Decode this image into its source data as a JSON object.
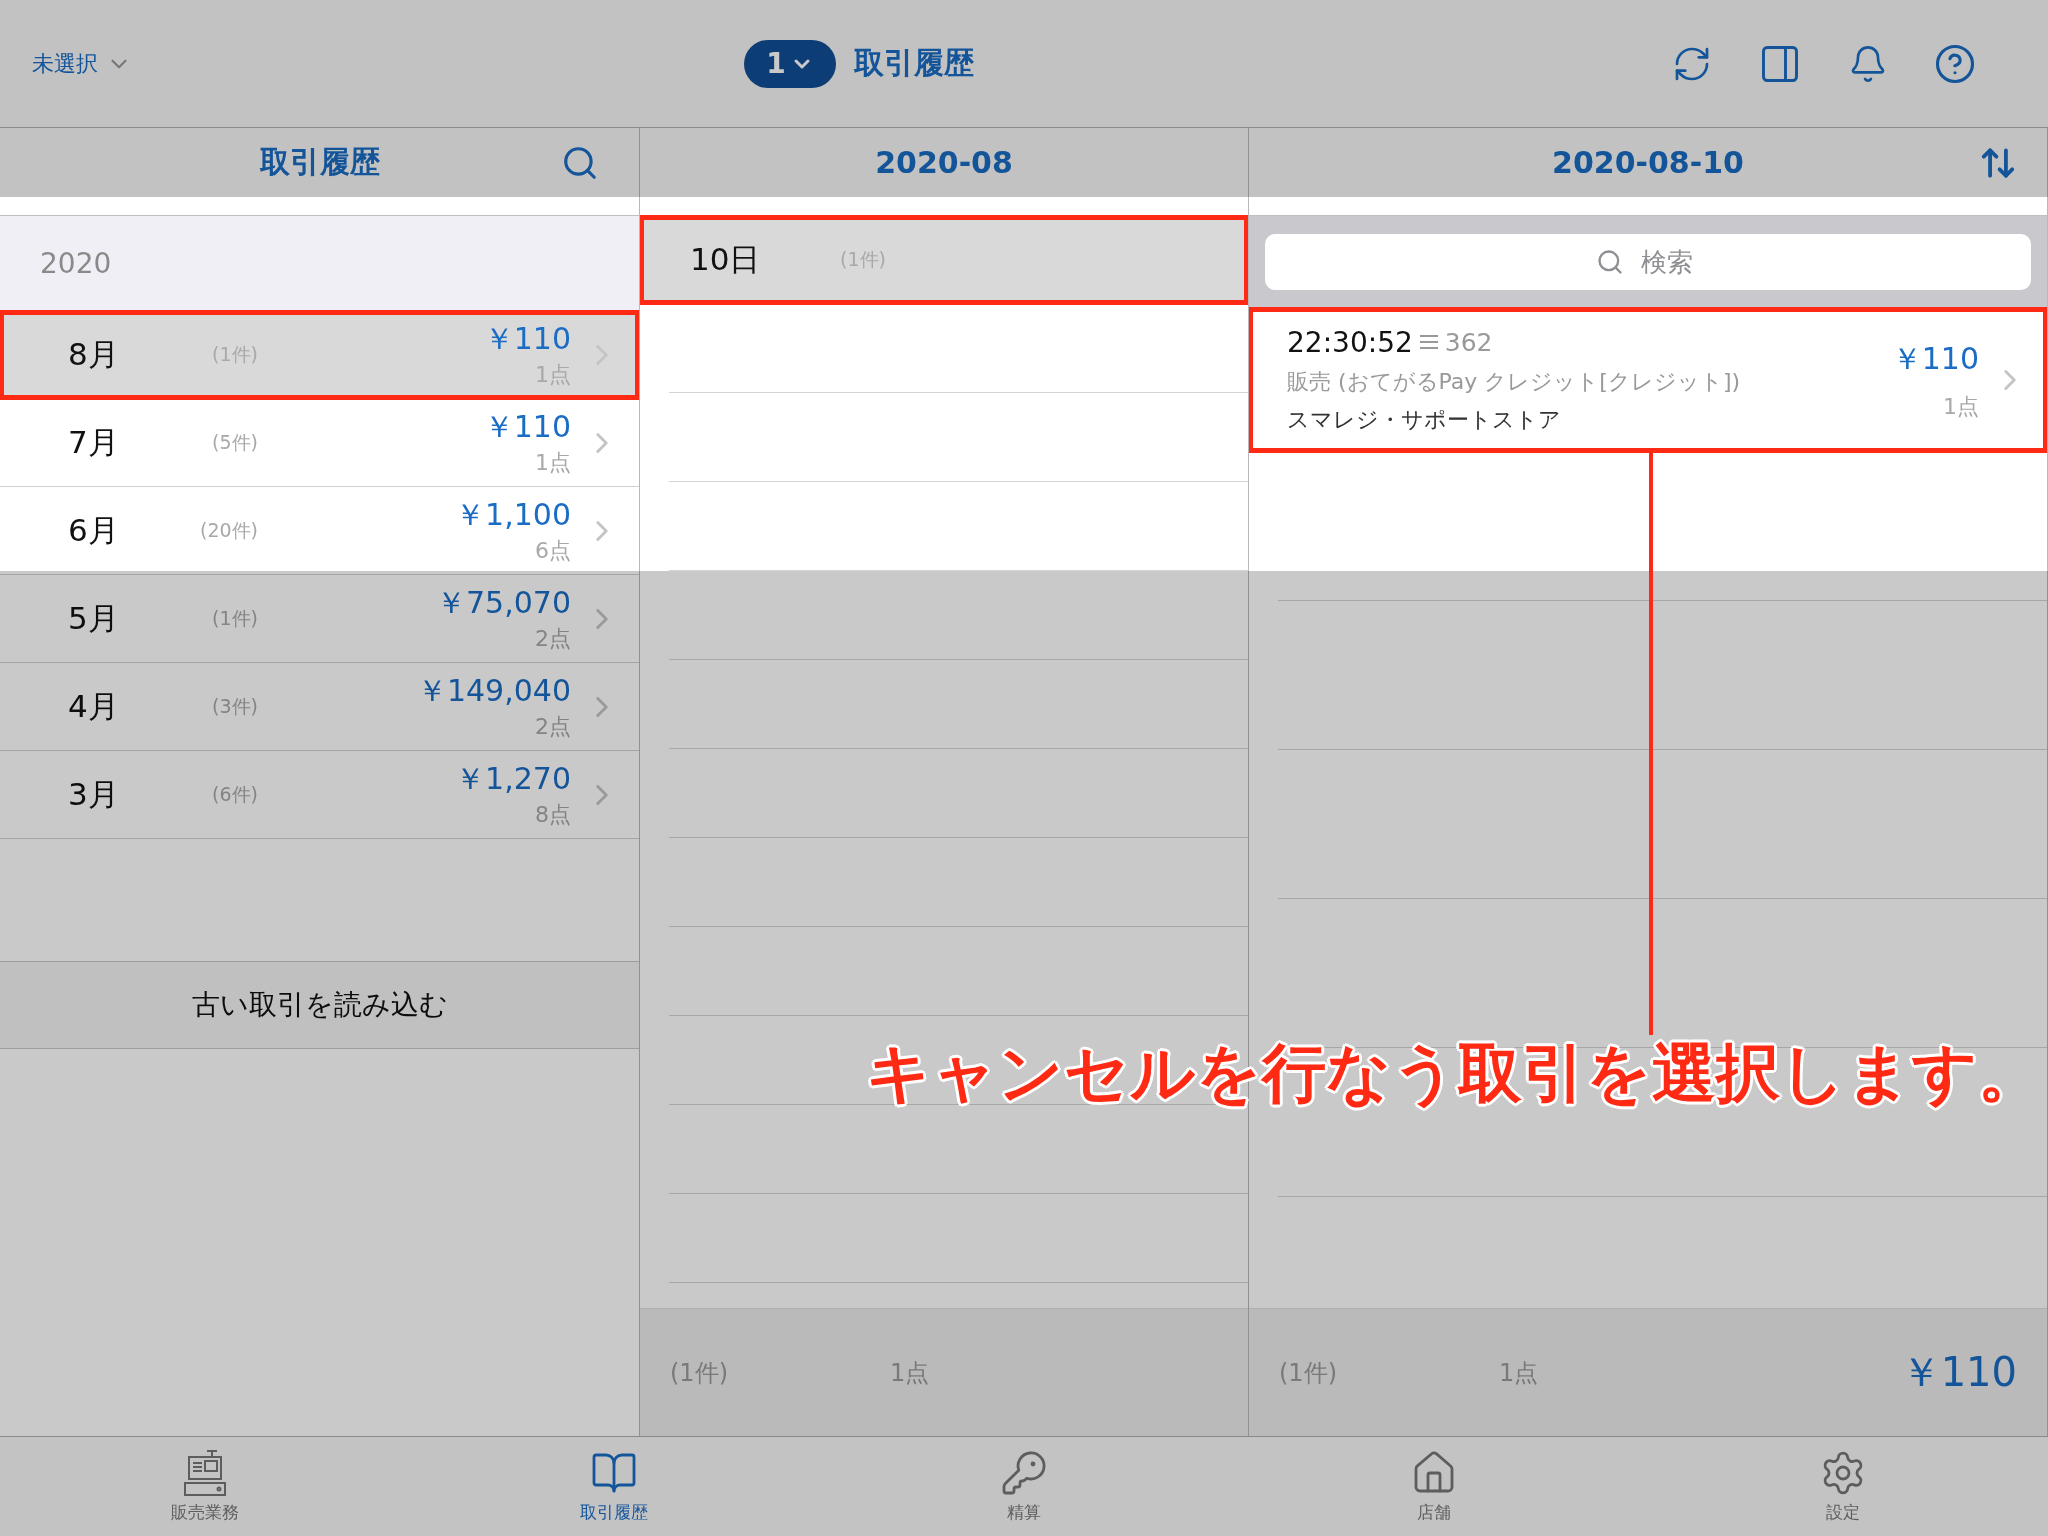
{
  "top_bar": {
    "store_selector": "未選択",
    "badge": "1",
    "title": "取引履歴"
  },
  "history": {
    "title": "取引履歴",
    "year": "2020",
    "months": [
      {
        "month": "8月",
        "count": "(1件)",
        "amount": "￥110",
        "items": "1点",
        "selected": true,
        "highlighted": true
      },
      {
        "month": "7月",
        "count": "(5件)",
        "amount": "￥110",
        "items": "1点",
        "selected": false,
        "highlighted": false
      },
      {
        "month": "6月",
        "count": "(20件)",
        "amount": "￥1,100",
        "items": "6点",
        "selected": false,
        "highlighted": false
      },
      {
        "month": "5月",
        "count": "(1件)",
        "amount": "￥75,070",
        "items": "2点",
        "selected": false,
        "highlighted": false
      },
      {
        "month": "4月",
        "count": "(3件)",
        "amount": "￥149,040",
        "items": "2点",
        "selected": false,
        "highlighted": false
      },
      {
        "month": "3月",
        "count": "(6件)",
        "amount": "￥1,270",
        "items": "8点",
        "selected": false,
        "highlighted": false
      }
    ],
    "load_more": "古い取引を読み込む"
  },
  "days": {
    "title": "2020-08",
    "rows": [
      {
        "day": "10日",
        "count": "(1件)",
        "selected": true,
        "highlighted": true
      }
    ],
    "footer": {
      "count": "(1件)",
      "items": "1点"
    }
  },
  "transactions": {
    "title": "2020-08-10",
    "search": {
      "placeholder": "検索"
    },
    "rows": [
      {
        "time": "22:30:52",
        "receipt": "362",
        "description": "販売 (おてがるPay クレジット[クレジット])",
        "store": "スマレジ・サポートストア",
        "amount": "￥110",
        "items": "1点",
        "highlighted": true
      }
    ],
    "footer": {
      "count": "(1件)",
      "items": "1点",
      "total": "￥110"
    }
  },
  "tabs": [
    {
      "label": "販売業務",
      "selected": false
    },
    {
      "label": "取引履歴",
      "selected": true
    },
    {
      "label": "精算",
      "selected": false
    },
    {
      "label": "店舗",
      "selected": false
    },
    {
      "label": "設定",
      "selected": false
    }
  ],
  "annotation": "キャンセルを行なう取引を選択します。"
}
